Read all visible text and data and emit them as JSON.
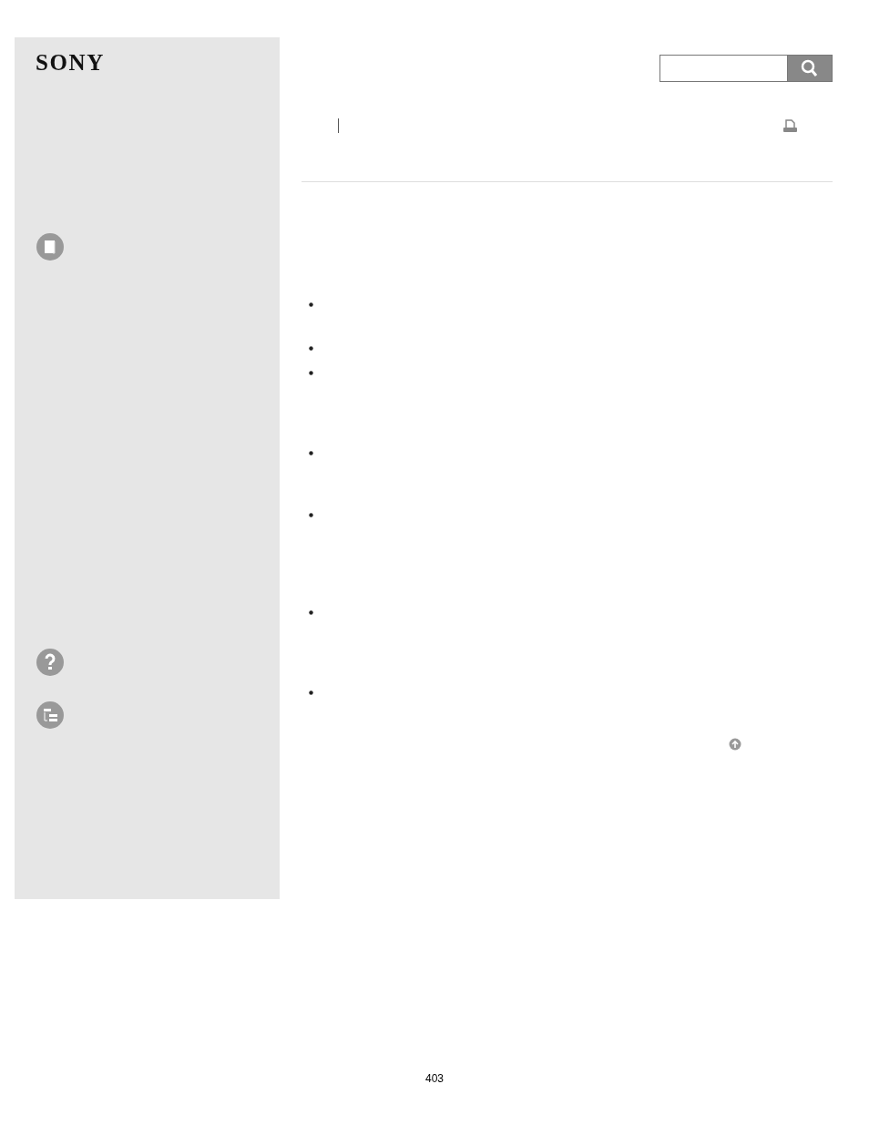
{
  "sidebar": {
    "logo": "SONY",
    "nav": [
      {
        "kind": "book"
      },
      {
        "kind": "help"
      },
      {
        "kind": "tree"
      }
    ]
  },
  "search": {
    "button": {
      "kind": "search"
    }
  },
  "content": {
    "bullets": [
      {
        "kind": "bullet"
      },
      {
        "kind": "bullet"
      },
      {
        "kind": "bullet"
      },
      {
        "kind": "bullet"
      },
      {
        "kind": "bullet"
      },
      {
        "kind": "bullet"
      },
      {
        "kind": "bullet"
      }
    ]
  },
  "footer": {
    "page_number": "403"
  }
}
